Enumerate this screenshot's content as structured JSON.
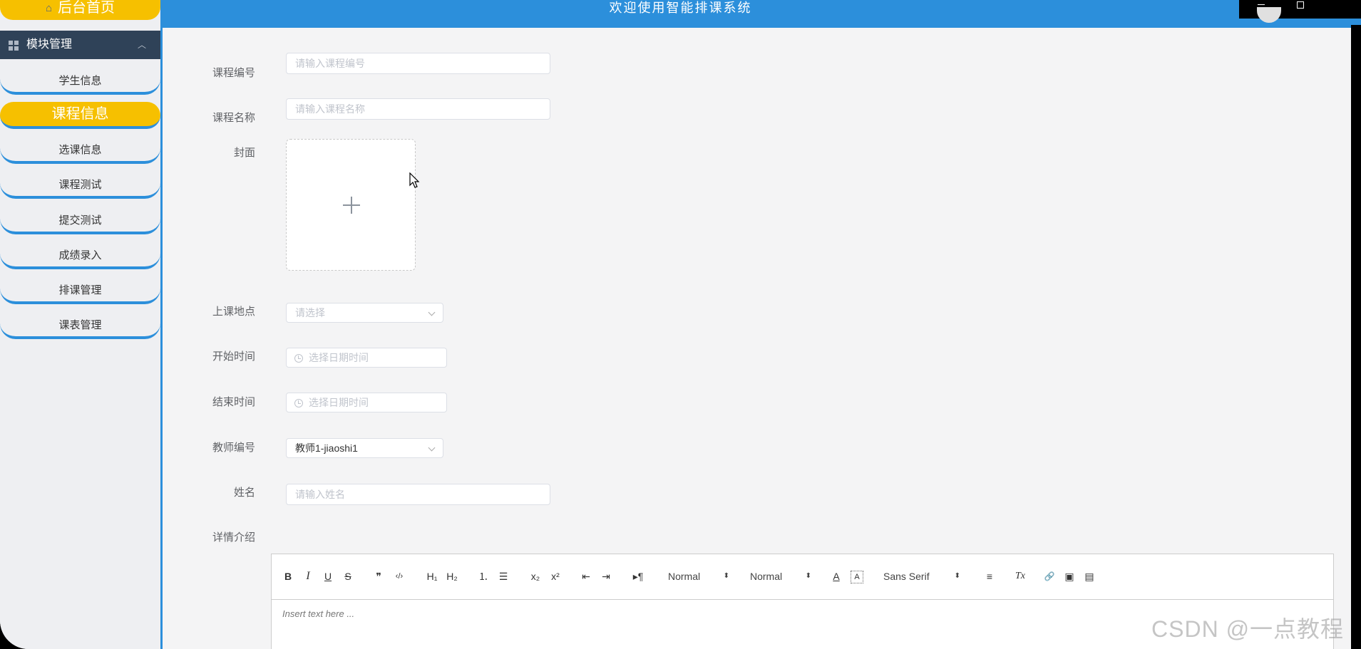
{
  "header": {
    "title": "欢迎使用智能排课系统"
  },
  "sidebar": {
    "home_label": "后台首页",
    "module_label": "模块管理",
    "items": [
      {
        "label": "学生信息"
      },
      {
        "label": "课程信息",
        "active": true
      },
      {
        "label": "选课信息"
      },
      {
        "label": "课程测试"
      },
      {
        "label": "提交测试"
      },
      {
        "label": "成绩录入"
      },
      {
        "label": "排课管理"
      },
      {
        "label": "课表管理"
      }
    ]
  },
  "form": {
    "course_no": {
      "label": "课程编号",
      "placeholder": "请输入课程编号"
    },
    "course_name": {
      "label": "课程名称",
      "placeholder": "请输入课程名称"
    },
    "cover": {
      "label": "封面"
    },
    "location": {
      "label": "上课地点",
      "placeholder": "请选择"
    },
    "start_time": {
      "label": "开始时间",
      "placeholder": "选择日期时间"
    },
    "end_time": {
      "label": "结束时间",
      "placeholder": "选择日期时间"
    },
    "teacher_no": {
      "label": "教师编号",
      "value": "教师1-jiaoshi1"
    },
    "name": {
      "label": "姓名",
      "placeholder": "请输入姓名"
    },
    "detail": {
      "label": "详情介绍"
    }
  },
  "editor": {
    "toolbar": {
      "bold": "B",
      "italic": "I",
      "underline": "U",
      "strike": "S",
      "quote": "❞",
      "code": "‹/›",
      "h1": "H₁",
      "h2": "H₂",
      "ordered_list": "⒈",
      "bullet_list": "☰",
      "subscript": "x₂",
      "superscript": "x²",
      "outdent": "⇤",
      "indent": "⇥",
      "direction": "▸¶",
      "size_picker": "Normal",
      "header_picker": "Normal",
      "font_picker": "Sans Serif",
      "color": "A",
      "background": "A",
      "align": "≡",
      "clean": "Tx",
      "link": "🔗",
      "image": "▣",
      "video": "▤"
    },
    "placeholder": "Insert text here ..."
  },
  "watermark": "CSDN @一点教程",
  "colors": {
    "primary": "#2c8fdb",
    "accent": "#f6c000",
    "sidebar_dark": "#2f4258"
  }
}
